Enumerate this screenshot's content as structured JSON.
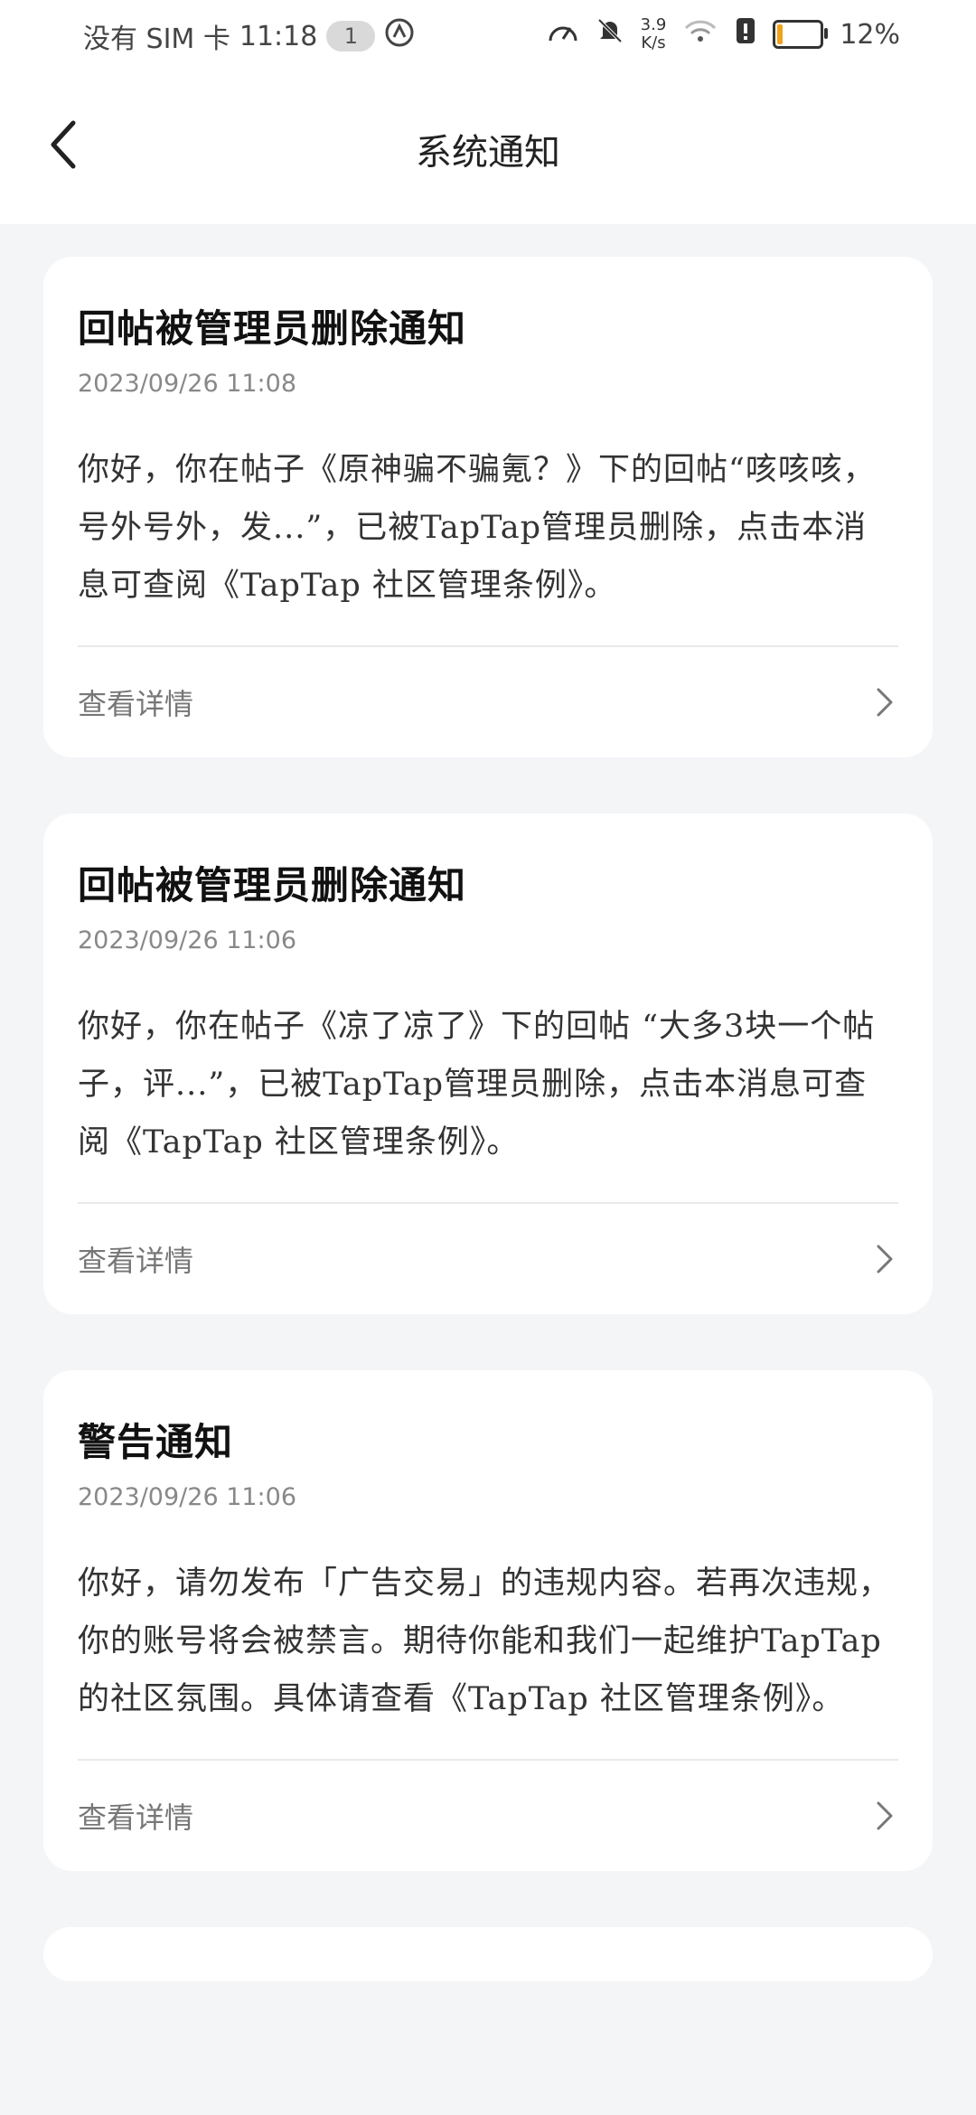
{
  "status_bar": {
    "carrier": "没有 SIM 卡",
    "time": "11:18",
    "notif_count": "1",
    "net_speed_value": "3.9",
    "net_speed_unit": "K/s",
    "battery": "12%",
    "battery_color": "#f0a21a"
  },
  "app_bar": {
    "title": "系统通知",
    "back_icon": "chevron-left-icon"
  },
  "notifications": [
    {
      "title": "回帖被管理员删除通知",
      "time": "2023/09/26  11:08",
      "body": "你好，你在帖子《原神骗不骗氪？》下的回帖“咳咳咳，号外号外，发...”，已被TapTap管理员删除，点击本消息可查阅《TapTap 社区管理条例》。",
      "action": "查看详情"
    },
    {
      "title": "回帖被管理员删除通知",
      "time": "2023/09/26  11:06",
      "body": "你好，你在帖子《凉了凉了》下的回帖 “大多3块一个帖子，评...”，已被TapTap管理员删除，点击本消息可查阅《TapTap 社区管理条例》。",
      "action": "查看详情"
    },
    {
      "title": "警告通知",
      "time": "2023/09/26  11:06",
      "body": "你好，请勿发布「广告交易」的违规内容。若再次违规，你的账号将会被禁言。期待你能和我们一起维护TapTap的社区氛围。具体请查看《TapTap 社区管理条例》。",
      "action": "查看详情"
    }
  ]
}
